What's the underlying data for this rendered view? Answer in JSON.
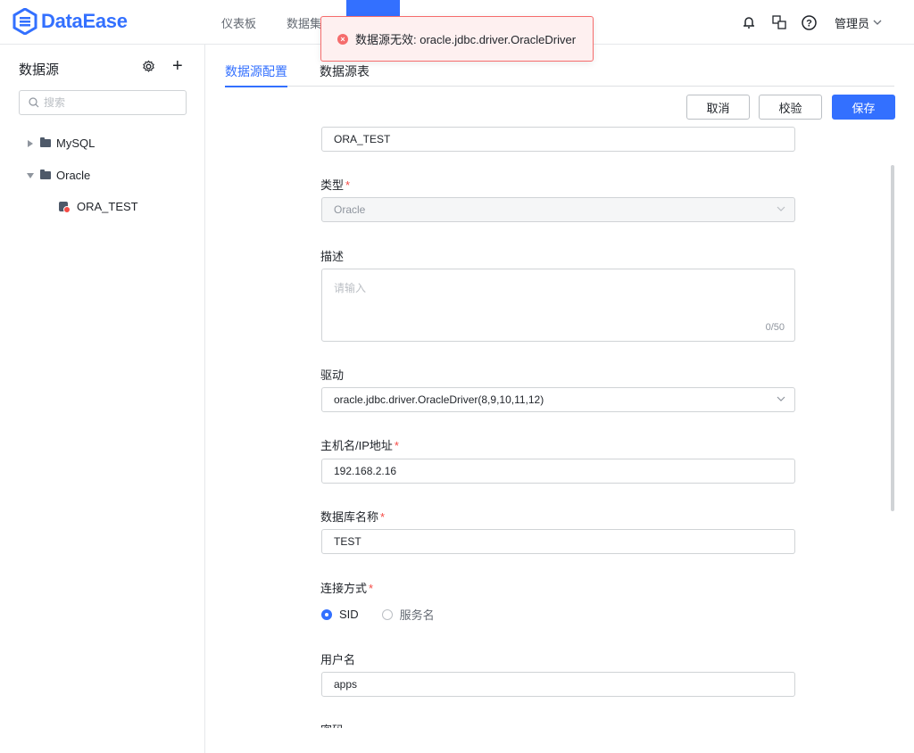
{
  "header": {
    "logo_text": "DataEase",
    "nav": [
      "仪表板",
      "数据集"
    ],
    "user": "管理员"
  },
  "toast": {
    "message": "数据源无效: oracle.jdbc.driver.OracleDriver"
  },
  "sidebar": {
    "title": "数据源",
    "search_placeholder": "搜索",
    "tree": [
      {
        "label": "MySQL",
        "expanded": false
      },
      {
        "label": "Oracle",
        "expanded": true,
        "children": [
          {
            "label": "ORA_TEST"
          }
        ]
      }
    ]
  },
  "tabs": [
    "数据源配置",
    "数据源表"
  ],
  "actions": {
    "cancel": "取消",
    "validate": "校验",
    "save": "保存"
  },
  "form": {
    "name_value": "ORA_TEST",
    "type_label": "类型",
    "type_value": "Oracle",
    "desc_label": "描述",
    "desc_placeholder": "请输入",
    "desc_count": "0/50",
    "driver_label": "驱动",
    "driver_value": "oracle.jdbc.driver.OracleDriver(8,9,10,11,12)",
    "host_label": "主机名/IP地址",
    "host_value": "192.168.2.16",
    "db_label": "数据库名称",
    "db_value": "TEST",
    "conn_label": "连接方式",
    "conn_options": [
      "SID",
      "服务名"
    ],
    "conn_selected": "SID",
    "user_label": "用户名",
    "user_value": "apps",
    "password_label": "密码"
  },
  "colors": {
    "primary": "#3370ff",
    "error": "#f56c6c",
    "required": "#f54a45"
  }
}
